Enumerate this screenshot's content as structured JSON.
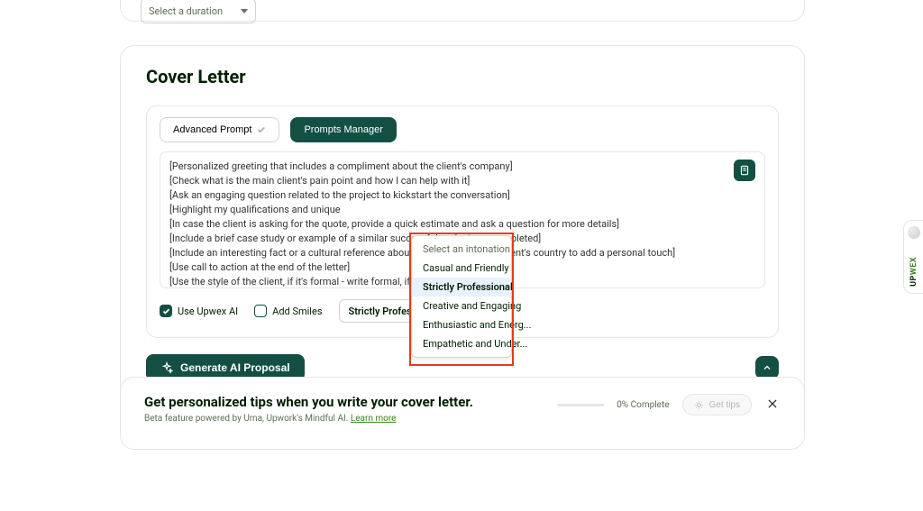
{
  "top_select": {
    "placeholder": "Select a duration"
  },
  "cover_letter": {
    "title": "Cover Letter",
    "advanced_prompt": "Advanced Prompt",
    "prompts_manager": "Prompts Manager",
    "textarea_lines": [
      "[Personalized greeting that includes a compliment about the client's company]",
      "[Check what is the main client's pain point and how I can help with it]",
      "[Ask an engaging question related to the project to kickstart the conversation]",
      "[Highlight my qualifications and unique",
      "[In case the client is asking for the quote, provide a quick estimate and ask a question for more details]",
      "[Include a brief case study or example of a similar successful project you completed]",
      "[Include an interesting fact or a cultural reference about your country or the client's country to add a personal touch]",
      "[Use call to action at the end of the letter]",
      "[Use the style of the client, if it's formal - write formal, if it's informal - informal]"
    ],
    "options": {
      "use_upwex_ai": "Use Upwex AI",
      "add_smiles": "Add Smiles",
      "intonation_selected": "Strictly Professional"
    },
    "dropdown": {
      "placeholder": "Select an intonation",
      "items": [
        "Casual and Friendly",
        "Strictly Professional",
        "Creative and Engaging",
        "Enthusiastic and Energ...",
        "Empathetic and Under..."
      ],
      "selected_index": 1
    },
    "generate_btn": "Generate AI Proposal"
  },
  "tips": {
    "title": "Get personalized tips when you write your cover letter.",
    "sub_prefix": "Beta feature powered by Uma, Upwork's Mindful AI. ",
    "learn_more": "Learn more",
    "progress": "0% Complete",
    "get_tips": "Get tips"
  },
  "side_tab": {
    "brand_up": "UP",
    "brand_wex": "WEX"
  }
}
